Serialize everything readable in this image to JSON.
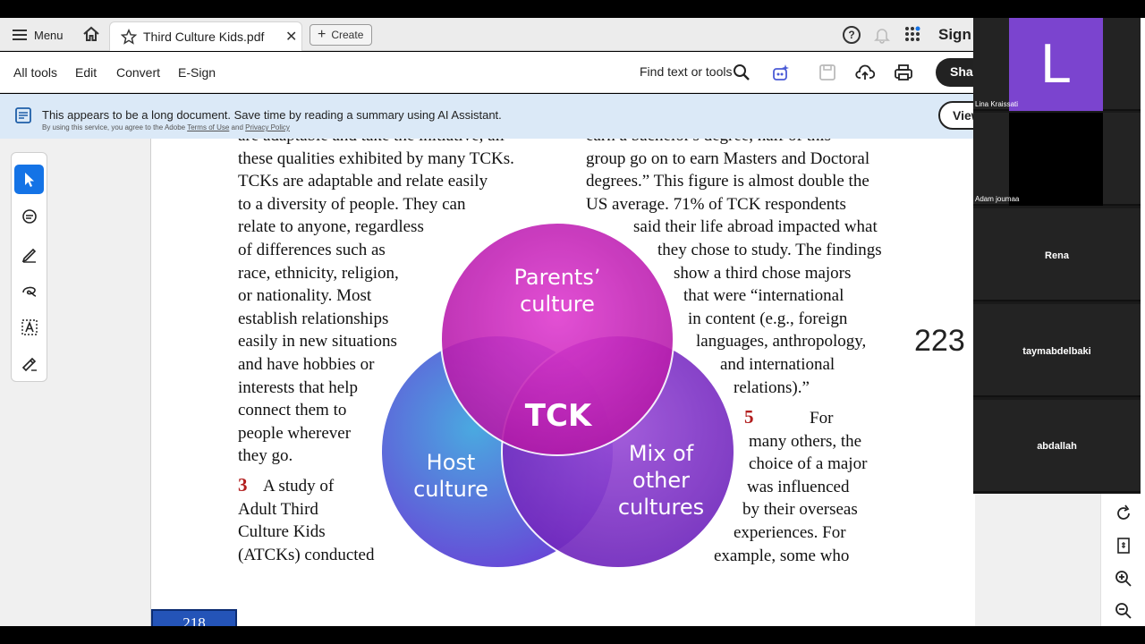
{
  "tabbar": {
    "menu_label": "Menu",
    "tab_title": "Third Culture Kids.pdf",
    "tab_close": "✕",
    "create_label": "Create",
    "create_plus": "+",
    "help_glyph": "?",
    "sign_in": "Sign i"
  },
  "toolbar": {
    "items": [
      "All tools",
      "Edit",
      "Convert",
      "E-Sign"
    ],
    "find_label": "Find text or tools",
    "share_label": "Shar"
  },
  "banner": {
    "text": "This appears to be a long document. Save time by reading a summary using AI Assistant.",
    "sub_prefix": "By using this service, you agree to the Adobe",
    "terms": "Terms of Use",
    "and": "and",
    "privacy": "Privacy Policy",
    "view_label": "View"
  },
  "page": {
    "left_lines": [
      "are adaptable and take the initiative, all",
      "these qualities exhibited by many TCKs.",
      "TCKs are adaptable and relate easily",
      "to a diversity of people. They can",
      "relate to anyone, regardless",
      "of differences such as",
      "race, ethnicity, religion,",
      "or nationality. Most",
      "establish relationships",
      "easily in new situations",
      "and have hobbies or",
      "interests that help",
      "connect them to",
      "people wherever",
      "they go."
    ],
    "num3": "3",
    "left_lines2": [
      "A study of",
      "Adult Third",
      "Culture Kids",
      "(ATCKs) conducted"
    ],
    "right_lines": [
      "earn a bachelor's degree, half of this",
      "group go on to earn Masters and Doctoral",
      "degrees.” This figure is almost double the",
      "US average. 71% of TCK respondents",
      "said their life abroad impacted what",
      "they chose to study. The findings",
      "show a third chose majors",
      "that were “international",
      "in content (e.g., foreign",
      "languages, anthropology,",
      "and international",
      "relations).”"
    ],
    "num5": "5",
    "right_lines2": [
      "For",
      "many others, the",
      "choice of a major",
      "was influenced",
      "by their overseas",
      "experiences. For",
      "example, some who"
    ],
    "footer_page": "218",
    "venn": {
      "top": [
        "Parents’",
        "culture"
      ],
      "left": [
        "Host",
        "culture"
      ],
      "right": [
        "Mix of",
        "other",
        "cultures"
      ],
      "center": "TCK"
    }
  },
  "side_page_number": "223",
  "meeting": {
    "participants": [
      {
        "name": "Lina Kraissati",
        "initial": "L"
      },
      {
        "name": "Adam joumaa"
      },
      {
        "name": "Rena"
      },
      {
        "name": "taymabdelbaki"
      },
      {
        "name": "abdallah"
      }
    ]
  },
  "colors": {
    "accent": "#1473e6",
    "avatar": "#7b44cf",
    "red_number": "#b21e1e",
    "footer_blue": "#2454b8"
  }
}
